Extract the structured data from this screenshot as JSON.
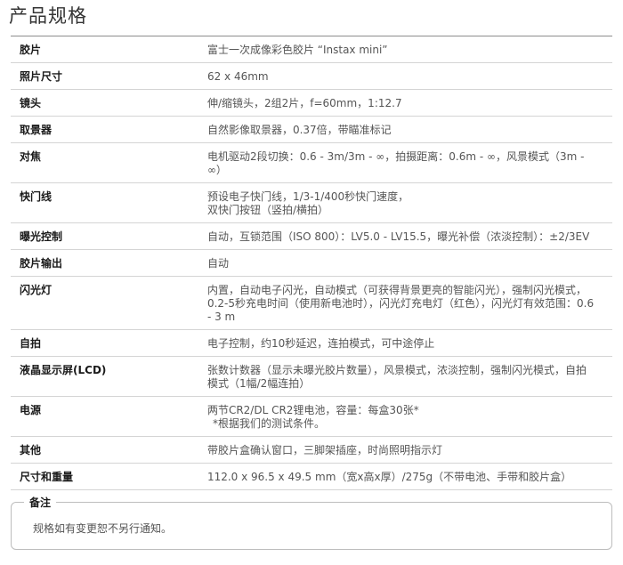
{
  "page_title": "产品规格",
  "specs": [
    {
      "label": "胶片",
      "lines": [
        "富士一次成像彩色胶片 “Instax mini”"
      ]
    },
    {
      "label": "照片尺寸",
      "lines": [
        "62 x 46mm"
      ]
    },
    {
      "label": "镜头",
      "lines": [
        "伸/缩镜头，2组2片，f=60mm，1:12.7"
      ]
    },
    {
      "label": "取景器",
      "lines": [
        "自然影像取景器，0.37倍，带瞄准标记"
      ]
    },
    {
      "label": "对焦",
      "lines": [
        "电机驱动2段切换：0.6 - 3m/3m - ∞，拍摄距离：0.6m - ∞，风景模式（3m -",
        "∞）"
      ]
    },
    {
      "label": "快门线",
      "lines": [
        "预设电子快门线，1/3-1/400秒快门速度，",
        "双快门按钮（竖拍/横拍）"
      ]
    },
    {
      "label": "曝光控制",
      "lines": [
        "自动，互锁范围（ISO 800）：LV5.0 - LV15.5，曝光补偿（浓淡控制）：±2/3EV"
      ]
    },
    {
      "label": "胶片输出",
      "lines": [
        "自动"
      ]
    },
    {
      "label": "闪光灯",
      "lines": [
        "内置，自动电子闪光，自动模式（可获得背景更亮的智能闪光），强制闪光模式，",
        "0.2-5秒充电时间（使用新电池时），闪光灯充电灯（红色），闪光灯有效范围：0.6",
        "- 3 m"
      ]
    },
    {
      "label": "自拍",
      "lines": [
        "电子控制，约10秒延迟，连拍模式，可中途停止"
      ]
    },
    {
      "label": "液晶显示屏(LCD)",
      "lines": [
        "张数计数器（显示未曝光胶片数量），风景模式，浓淡控制，强制闪光模式，自拍",
        "模式（1幅/2幅连拍）"
      ]
    },
    {
      "label": "电源",
      "lines": [
        "两节CR2/DL CR2锂电池，容量：每盒30张*"
      ],
      "note": "*根据我们的测试条件。"
    },
    {
      "label": "其他",
      "lines": [
        "带胶片盒确认窗口，三脚架插座，时尚照明指示灯"
      ]
    },
    {
      "label": "尺寸和重量",
      "lines": [
        "112.0 x 96.5 x 49.5 mm（宽x高x厚）/275g（不带电池、手带和胶片盒）"
      ]
    }
  ],
  "remark": {
    "legend": "备注",
    "text": "规格如有变更恕不另行通知。"
  }
}
